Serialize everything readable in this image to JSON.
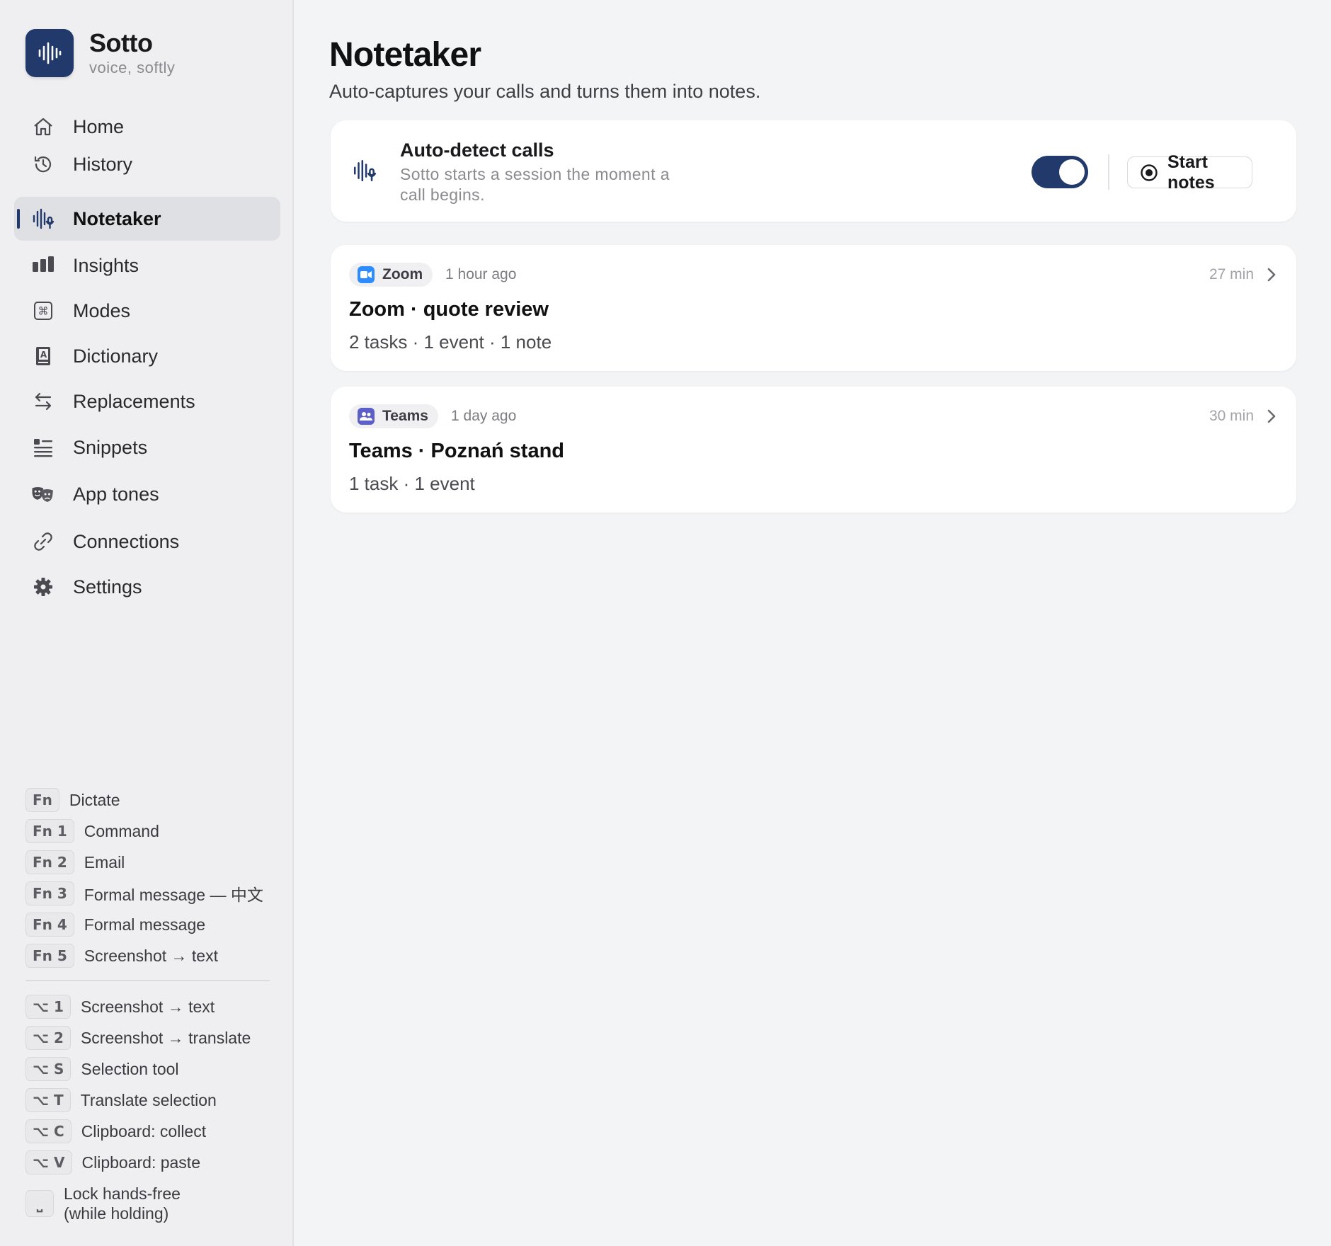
{
  "brand": {
    "name": "Sotto",
    "tagline": "voice, softly"
  },
  "nav": {
    "items": [
      {
        "label": "Home",
        "icon": "home-icon"
      },
      {
        "label": "History",
        "icon": "history-icon"
      },
      {
        "label": "Notetaker",
        "icon": "waveform-mic-icon",
        "active": true
      },
      {
        "label": "Insights",
        "icon": "bar-chart-icon"
      },
      {
        "label": "Modes",
        "icon": "command-key-icon"
      },
      {
        "label": "Dictionary",
        "icon": "book-icon"
      },
      {
        "label": "Replacements",
        "icon": "swap-arrows-icon"
      },
      {
        "label": "Snippets",
        "icon": "snippets-icon"
      },
      {
        "label": "App tones",
        "icon": "theater-masks-icon"
      },
      {
        "label": "Connections",
        "icon": "link-icon"
      },
      {
        "label": "Settings",
        "icon": "gear-icon"
      }
    ]
  },
  "shortcuts": {
    "fn": [
      {
        "key": "Fn",
        "label": "Dictate"
      },
      {
        "key": "Fn 1",
        "label": "Command"
      },
      {
        "key": "Fn 2",
        "label": "Email"
      },
      {
        "key": "Fn 3",
        "label": "Formal message — 中文"
      },
      {
        "key": "Fn 4",
        "label": "Formal message"
      },
      {
        "key": "Fn 5",
        "label": "Screenshot → text"
      }
    ],
    "option": [
      {
        "key": "⌥ 1",
        "label": "Screenshot → text"
      },
      {
        "key": "⌥ 2",
        "label": "Screenshot → translate"
      },
      {
        "key": "⌥ S",
        "label": "Selection tool"
      },
      {
        "key": "⌥ T",
        "label": "Translate selection"
      },
      {
        "key": "⌥ C",
        "label": "Clipboard: collect"
      },
      {
        "key": "⌥ V",
        "label": "Clipboard: paste"
      }
    ],
    "hands_free": {
      "key": "⎵",
      "line1": "Lock hands-free",
      "line2": "(while holding)"
    }
  },
  "main": {
    "title": "Notetaker",
    "subtitle": "Auto-captures your calls and turns them into notes.",
    "auto_detect": {
      "title": "Auto-detect calls",
      "description": "Sotto starts a session the moment a call begins.",
      "enabled": true,
      "start_label": "Start notes"
    },
    "calls": [
      {
        "app": "Zoom",
        "app_color": "#2d8cff",
        "when": "1 hour ago",
        "duration": "27 min",
        "title": "Zoom · quote review",
        "summary": "2 tasks · 1 event · 1 note"
      },
      {
        "app": "Teams",
        "app_color": "#5b5fc7",
        "when": "1 day ago",
        "duration": "30 min",
        "title": "Teams · Poznań stand",
        "summary": "1 task · 1 event"
      }
    ]
  },
  "colors": {
    "accent": "#213a6b",
    "zoom": "#2d8cff",
    "teams": "#5b5fc7"
  }
}
